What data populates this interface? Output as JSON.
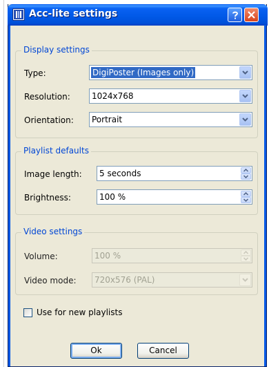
{
  "window": {
    "title": "Acc-lite settings",
    "icons": {
      "app": "app-logo-icon",
      "help": "help-icon",
      "close": "close-icon"
    },
    "colors": {
      "titlebar": "#0058e6",
      "group_title": "#0046d5",
      "face": "#ece9d8"
    }
  },
  "display_settings": {
    "title": "Display settings",
    "type_label": "Type:",
    "type_value": "DigiPoster (Images only)",
    "resolution_label": "Resolution:",
    "resolution_value": "1024x768",
    "orientation_label": "Orientation:",
    "orientation_value": "Portrait"
  },
  "playlist_defaults": {
    "title": "Playlist defaults",
    "image_length_label": "Image length:",
    "image_length_value": "5 seconds",
    "brightness_label": "Brightness:",
    "brightness_value": "100 %"
  },
  "video_settings": {
    "title": "Video settings",
    "volume_label": "Volume:",
    "volume_value": "100 %",
    "video_mode_label": "Video mode:",
    "video_mode_value": "720x576 (PAL)"
  },
  "options": {
    "use_for_new_playlists_label": "Use for new playlists",
    "use_for_new_playlists_checked": false
  },
  "buttons": {
    "ok": "Ok",
    "cancel": "Cancel"
  }
}
